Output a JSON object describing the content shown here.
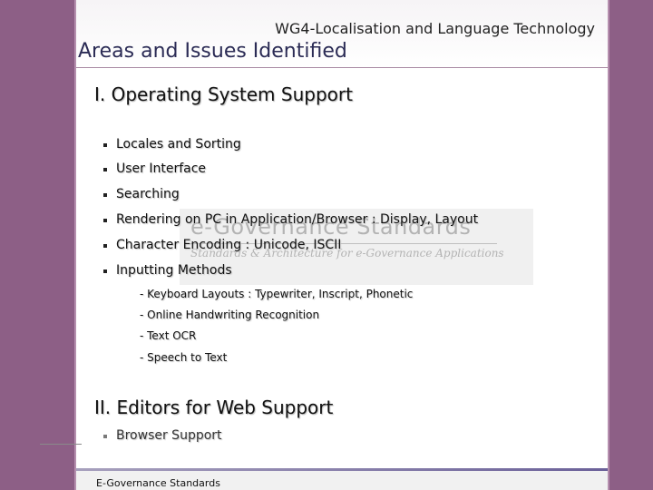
{
  "header": {
    "title": "WG4-Localisation and Language Technology"
  },
  "slide": {
    "title": "Areas and Issues Identified"
  },
  "watermark": {
    "title": "e-Governance Standards",
    "subtitle": "Standards & Architecture for e-Governance Applications"
  },
  "section1": {
    "heading": "I. Operating System Support",
    "items": [
      "Locales and Sorting",
      "User Interface",
      "Searching",
      "Rendering on PC in Application/Browser : Display, Layout",
      "Character Encoding : Unicode, ISCII",
      "Inputting Methods"
    ],
    "subitems": [
      "- Keyboard Layouts : Typewriter, Inscript, Phonetic",
      "- Online Handwriting Recognition",
      "- Text OCR",
      "- Speech  to Text"
    ]
  },
  "section2": {
    "heading": "II. Editors for Web Support",
    "items": [
      "Browser Support"
    ]
  },
  "footer": {
    "text": "E-Governance Standards"
  },
  "colors": {
    "side_bar": "#8d5f86",
    "title_text": "#2b2b55",
    "footer_line": "#6b6199"
  }
}
